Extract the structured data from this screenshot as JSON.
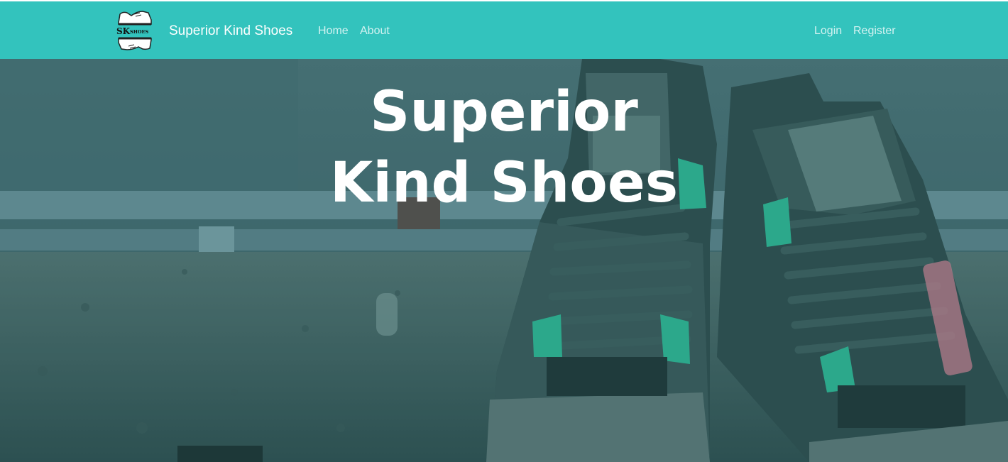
{
  "navbar": {
    "logo_text": "SKshoes",
    "brand": "Superior Kind Shoes",
    "links": [
      "Home",
      "About"
    ],
    "auth_links": [
      "Login",
      "Register"
    ],
    "background": "#33c3bd"
  },
  "hero": {
    "title": "Superior Kind Shoes",
    "overlay_color": "#1f6f6e",
    "shoe_accent": "#2fb592"
  }
}
